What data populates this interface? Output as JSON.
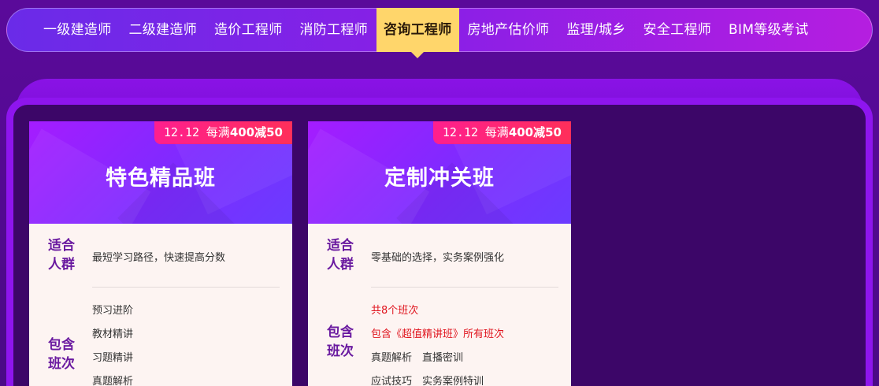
{
  "nav": {
    "items": [
      {
        "label": "一级建造师",
        "active": false
      },
      {
        "label": "二级建造师",
        "active": false
      },
      {
        "label": "造价工程师",
        "active": false
      },
      {
        "label": "消防工程师",
        "active": false
      },
      {
        "label": "咨询工程师",
        "active": true
      },
      {
        "label": "房地产估价师",
        "active": false
      },
      {
        "label": "监理/城乡",
        "active": false
      },
      {
        "label": "安全工程师",
        "active": false
      },
      {
        "label": "BIM等级考试",
        "active": false
      }
    ]
  },
  "cards": [
    {
      "promo_date": "12.12",
      "promo_prefix": "每满",
      "promo_amount": "400减50",
      "title": "特色精品班",
      "suit_label_1": "适合",
      "suit_label_2": "人群",
      "suit_text": "最短学习路径，快速提高分数",
      "include_label_1": "包含",
      "include_label_2": "班次",
      "items": [
        "预习进阶",
        "教材精讲",
        "习题精讲",
        "真题解析"
      ]
    },
    {
      "promo_date": "12.12",
      "promo_prefix": "每满",
      "promo_amount": "400减50",
      "title": "定制冲关班",
      "suit_label_1": "适合",
      "suit_label_2": "人群",
      "suit_text": "零基础的选择，实务案例强化",
      "include_label_1": "包含",
      "include_label_2": "班次",
      "items": [
        "共8个班次",
        "包含《超值精讲班》所有班次",
        "真题解析　直播密训",
        "应试技巧　实务案例特训"
      ]
    }
  ],
  "colors": {
    "accent_yellow": "#ffd66b",
    "promo_pink": "#ff1f8e",
    "label_purple": "#6a1aa0",
    "highlight_red": "#e0141e"
  }
}
